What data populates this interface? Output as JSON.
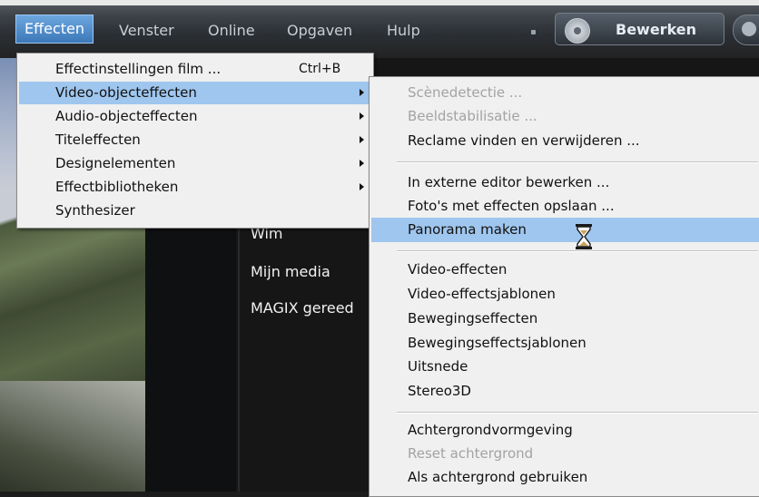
{
  "menubar": {
    "items": [
      "Effecten",
      "Venster",
      "Online",
      "Opgaven",
      "Hulp"
    ],
    "bewerken_label": "Bewerken"
  },
  "background": {
    "labels": [
      "Wim",
      "Mijn media",
      "MAGIX gereed"
    ]
  },
  "menu_effecten": {
    "items": [
      {
        "label": "Effectinstellingen film ...",
        "shortcut": "Ctrl+B"
      },
      {
        "label": "Video-objecteffecten"
      },
      {
        "label": "Audio-objecteffecten"
      },
      {
        "label": "Titeleffecten"
      },
      {
        "label": "Designelementen"
      },
      {
        "label": "Effectbibliotheken"
      },
      {
        "label": "Synthesizer"
      }
    ]
  },
  "menu_video_object": {
    "items": [
      {
        "label": "Scènedetectie ..."
      },
      {
        "label": "Beeldstabilisatie ..."
      },
      {
        "label": "Reclame vinden en verwijderen ..."
      },
      {
        "label": "In externe editor bewerken ..."
      },
      {
        "label": "Foto's met effecten opslaan ..."
      },
      {
        "label": "Panorama maken"
      },
      {
        "label": "Video-effecten"
      },
      {
        "label": "Video-effectsjablonen"
      },
      {
        "label": "Bewegingseffecten"
      },
      {
        "label": "Bewegingseffectsjablonen"
      },
      {
        "label": "Uitsnede"
      },
      {
        "label": "Stereo3D"
      },
      {
        "label": "Achtergrondvormgeving"
      },
      {
        "label": "Reset achtergrond"
      },
      {
        "label": "Als achtergrond gebruiken"
      }
    ]
  },
  "colors": {
    "selection": "#9fc6ee",
    "menu_bg": "#f0f0f0",
    "disabled_text": "#a3a3a3"
  },
  "icons": [
    "film-reel-icon",
    "submenu-arrow-icon",
    "hourglass-cursor-icon"
  ]
}
